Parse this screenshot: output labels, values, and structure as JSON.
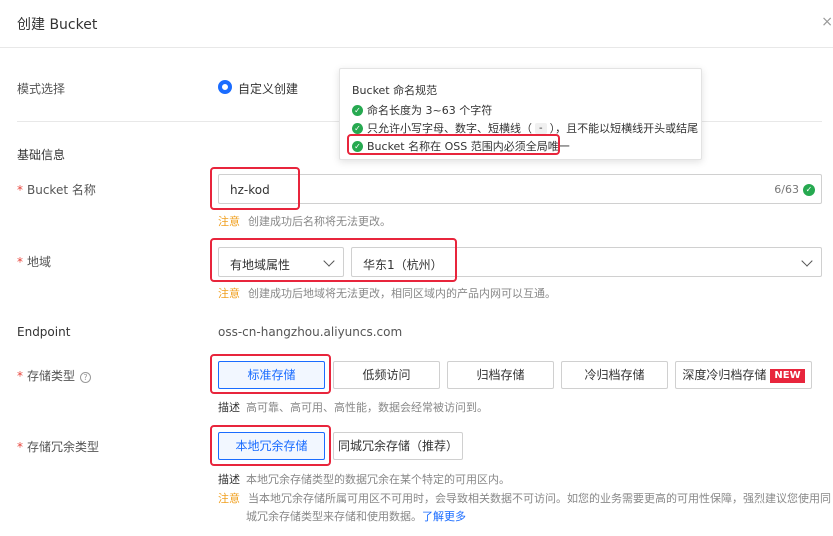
{
  "header": {
    "title": "创建 Bucket",
    "close": "×"
  },
  "mode": {
    "label": "模式选择",
    "option": "自定义创建"
  },
  "tooltip": {
    "title": "Bucket 命名规范",
    "rule1": "命名长度为 3~63 个字符",
    "rule2_pre": "只允许小写字母、数字、短横线（",
    "rule2_dash": "-",
    "rule2_post": "），且不能以短横线开头或结尾",
    "rule3": "Bucket 名称在 OSS 范围内必须全局唯一"
  },
  "basic": {
    "section_title": "基础信息"
  },
  "bucket_name": {
    "required": "*",
    "label": "Bucket 名称",
    "value": "hz-kod",
    "count": "6/63",
    "hint_warn": "注意",
    "hint": "创建成功后名称将无法更改。"
  },
  "region": {
    "required": "*",
    "label": "地域",
    "attr_select": "有地域属性",
    "region_select": "华东1（杭州）",
    "hint_warn": "注意",
    "hint": "创建成功后地域将无法更改，相同区域内的产品内网可以互通。"
  },
  "endpoint": {
    "label": "Endpoint",
    "value": "oss-cn-hangzhou.aliyuncs.com"
  },
  "storage_class": {
    "required": "*",
    "label": "存储类型",
    "help": "?",
    "options": [
      "标准存储",
      "低频访问",
      "归档存储",
      "冷归档存储",
      "深度冷归档存储"
    ],
    "new_badge": "NEW",
    "desc_label": "描述",
    "desc": "高可靠、高可用、高性能，数据会经常被访问到。"
  },
  "redundancy": {
    "required": "*",
    "label": "存储冗余类型",
    "options": [
      "本地冗余存储",
      "同城冗余存储（推荐）"
    ],
    "desc_label": "描述",
    "desc": "本地冗余存储类型的数据冗余在某个特定的可用区内。",
    "warn_label": "注意",
    "warn_line1": "当本地冗余存储所属可用区不可用时，会导致相关数据不可访问。如您的业务需要更高的可用性保障，强烈建议您使用同",
    "warn_line2": "城冗余存储类型来存储和使用数据。",
    "learn_more": "了解更多"
  },
  "colors": {
    "accent": "#1a6cff",
    "success": "#26a950",
    "warning": "#f0a020",
    "highlight": "#e8253c"
  }
}
